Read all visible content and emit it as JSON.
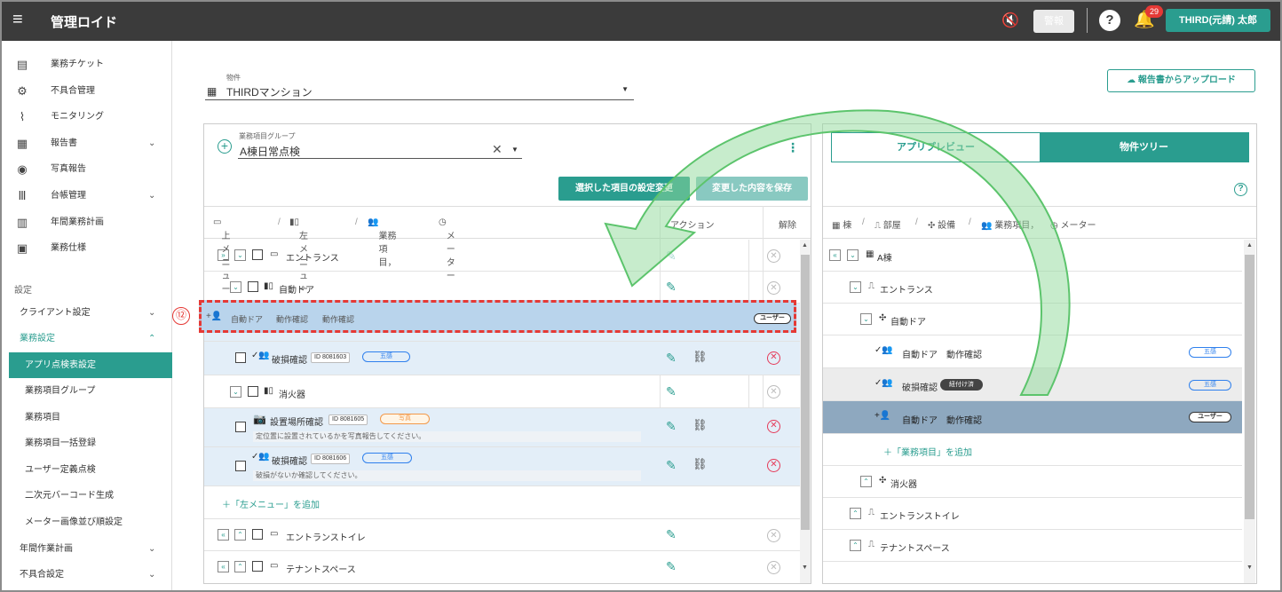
{
  "app": {
    "title": "管理ロイド",
    "menu_icon": "≡",
    "alarm_label": "警報",
    "user": "THIRD(元請) 太郎",
    "notif_count": "29"
  },
  "sidebar": {
    "items": [
      {
        "icon": "▤",
        "label": "業務チケット"
      },
      {
        "icon": "⚙",
        "label": "不具合管理"
      },
      {
        "icon": "⌇",
        "label": "モニタリング"
      },
      {
        "icon": "▦",
        "label": "報告書"
      },
      {
        "icon": "◉",
        "label": "写真報告"
      },
      {
        "icon": "Ⅲ",
        "label": "台帳管理"
      },
      {
        "icon": "▥",
        "label": "年間業務計画"
      },
      {
        "icon": "▣",
        "label": "業務仕様"
      }
    ],
    "settings_label": "設定",
    "client": "クライアント設定",
    "work_settings": "業務設定",
    "app_check": "アプリ点検表設定",
    "sub": [
      "業務項目グループ",
      "業務項目",
      "業務項目一括登録",
      "ユーザー定義点検",
      "二次元バーコード生成",
      "メーター画像並び順設定"
    ],
    "annual": "年間作業計画",
    "defect": "不具合設定"
  },
  "property": {
    "label": "物件",
    "value": "THIRDマンション"
  },
  "upload_label": "報告書からアップロード",
  "group": {
    "label": "業務項目グループ",
    "value": "A棟日常点検"
  },
  "buttons": {
    "change_selected": "選択した項目の設定変更",
    "save_changes": "変更した内容を保存"
  },
  "header": {
    "upper": "上メニュー",
    "left": "左メニュー",
    "items": "業務項目，",
    "meter": "メーター",
    "action": "アクション",
    "remove": "解除"
  },
  "rows": {
    "entrance": "エントランス",
    "autodoor": "自動ドア",
    "drag_text1": "自動ドア",
    "drag_text2": "動作確認",
    "drag_badge": "ユーザー",
    "damage": "破損確認",
    "damage_id": "ID 8081603",
    "pill_five": "五感",
    "extinguisher": "消火器",
    "install": "設置場所確認",
    "install_id": "ID 8081605",
    "pill_photo": "写真",
    "install_desc": "定位置に設置されているかを写真報告してください。",
    "damage2": "破損確認",
    "damage2_id": "ID 8081606",
    "damage2_desc": "破損がないか確認してください。",
    "add_left": "＋「左メニュー」を追加",
    "entrance_toilet": "エントランストイレ",
    "tenant": "テナントスペース"
  },
  "right": {
    "tab_preview": "アプリプレビュー",
    "tab_tree": "物件ツリー",
    "hdr_building": "棟",
    "hdr_room": "部屋",
    "hdr_equip": "設備",
    "hdr_items": "業務項目，",
    "hdr_meter": "メーター",
    "building": "A棟",
    "entrance": "エントランス",
    "autodoor": "自動ドア",
    "item1a": "自動ドア",
    "item1b": "動作確認",
    "item2": "破損確認",
    "linked": "紐付け済",
    "item3a": "自動ドア",
    "item3b": "動作確認",
    "user_badge": "ユーザー",
    "add_item": "＋「業務項目」を追加",
    "extinguisher": "消火器",
    "entrance_toilet": "エントランストイレ",
    "tenant": "テナントスペース"
  },
  "callout": "⑫"
}
